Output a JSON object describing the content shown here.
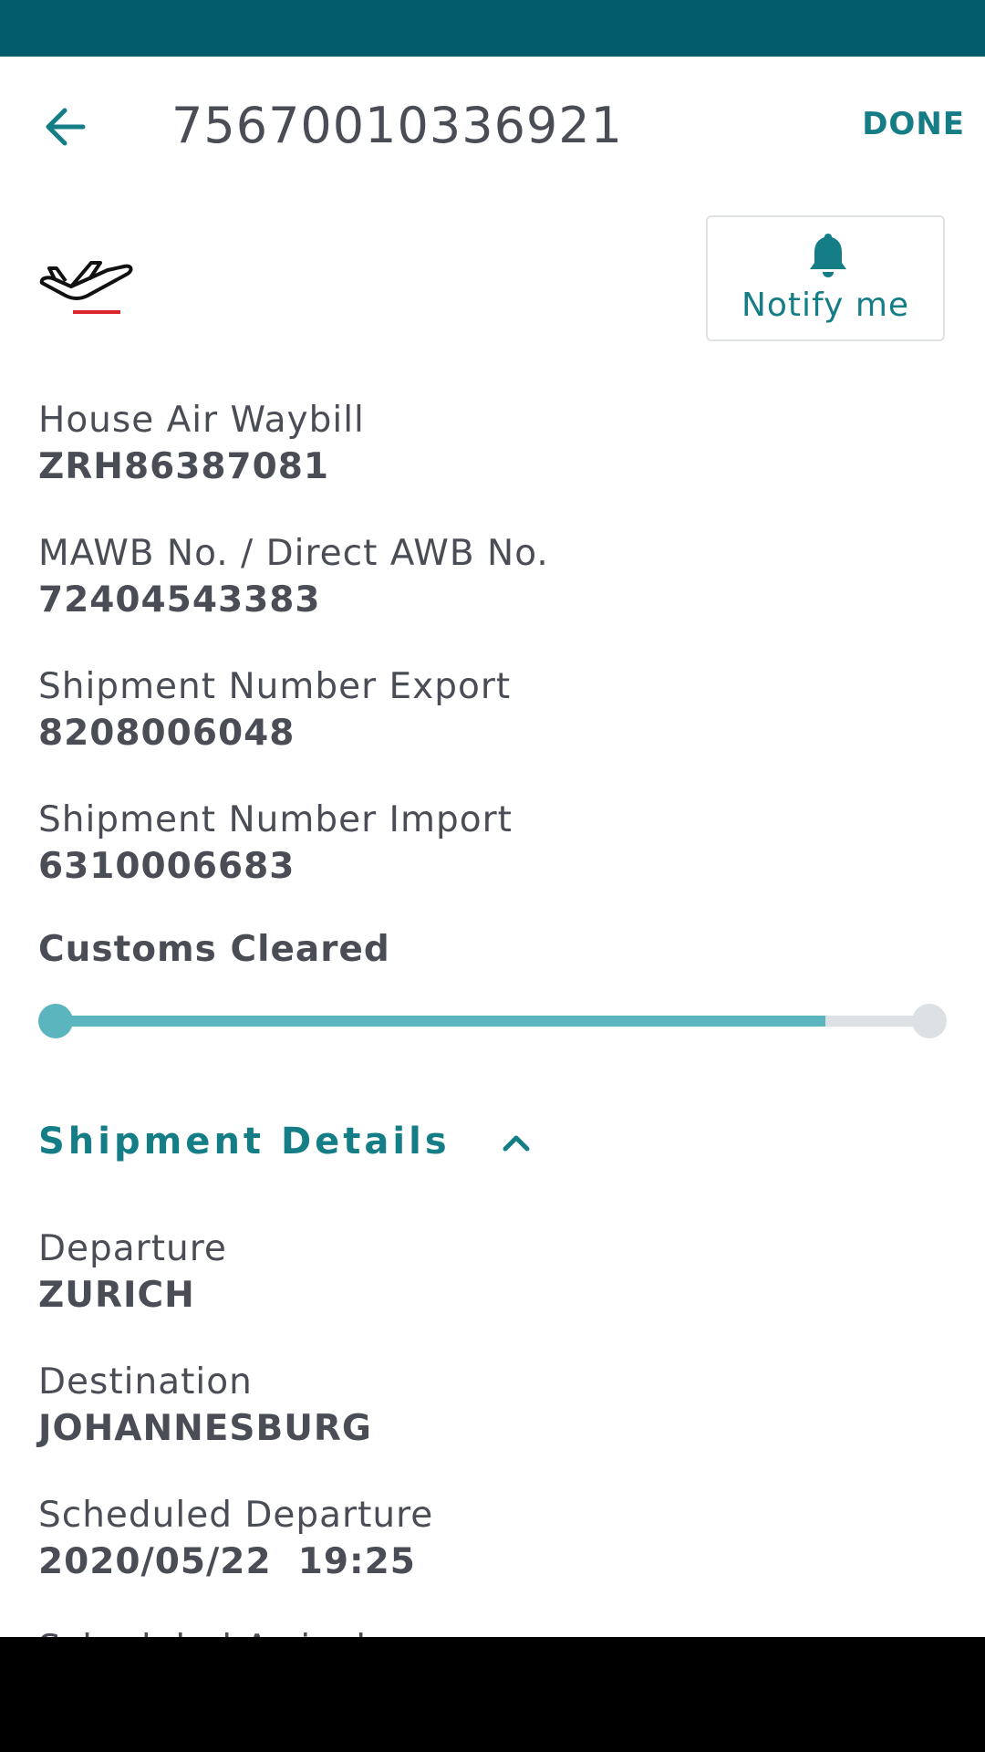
{
  "app_bar": {
    "title": "75670010336921",
    "done_label": "DONE"
  },
  "notify": {
    "label": "Notify me"
  },
  "fields": [
    {
      "label": "House Air Waybill",
      "value": "ZRH86387081"
    },
    {
      "label": "MAWB No. / Direct AWB No.",
      "value": "72404543383"
    },
    {
      "label": "Shipment Number Export",
      "value": "8208006048"
    },
    {
      "label": "Shipment Number Import",
      "value": "6310006683"
    }
  ],
  "status": {
    "label": "Customs Cleared",
    "progress_fraction": 0.88
  },
  "shipment_details": {
    "header": "Shipment Details",
    "fields": [
      {
        "label": "Departure",
        "value": "ZURICH"
      },
      {
        "label": "Destination",
        "value": "JOHANNESBURG"
      },
      {
        "label": "Scheduled Departure",
        "value": "2020/05/22  19:25"
      },
      {
        "label": "Scheduled Arrival",
        "value": ""
      }
    ]
  },
  "colors": {
    "status_bar": "#025c6b",
    "accent": "#147d86",
    "progress_fill": "#5bb5bf",
    "progress_track": "#dde1e4",
    "plane_underline": "#d9262b"
  }
}
